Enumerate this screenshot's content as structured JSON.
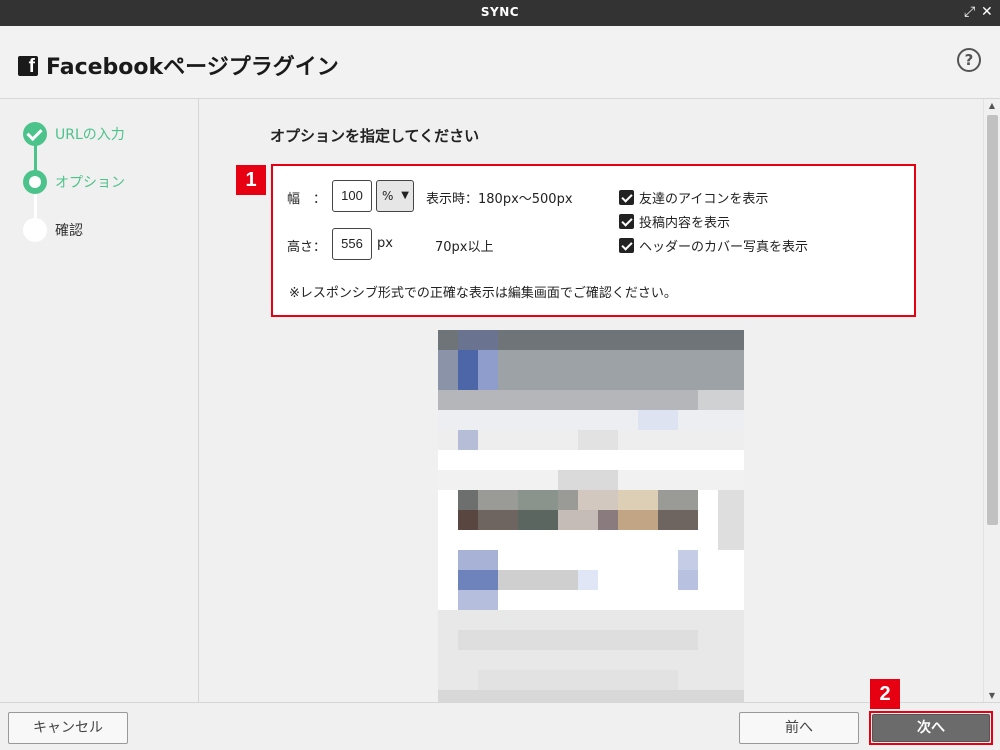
{
  "window": {
    "title": "SYNC",
    "expand_glyph": "⤢",
    "close_glyph": "✕"
  },
  "header": {
    "title": "Facebookページプラグイン",
    "icon": "facebook-icon",
    "icon_glyph": "f",
    "help_glyph": "?"
  },
  "sidebar": {
    "steps": [
      {
        "label": "URLの入力",
        "state": "done"
      },
      {
        "label": "オプション",
        "state": "active"
      },
      {
        "label": "確認",
        "state": "todo"
      }
    ]
  },
  "main": {
    "heading": "オプションを指定してください",
    "options": {
      "badge": "1",
      "width_label": "幅　：",
      "width_value": "100",
      "width_unit": "%",
      "width_hint": "表示時：180px〜500px",
      "height_label": "高さ：",
      "height_value": "556",
      "height_unit": "px",
      "height_hint": "70px以上",
      "checkboxes": [
        {
          "label": "友達のアイコンを表示",
          "checked": true
        },
        {
          "label": "投稿内容を表示",
          "checked": true
        },
        {
          "label": "ヘッダーのカバー写真を表示",
          "checked": true
        }
      ],
      "note": "※レスポンシブ形式での正確な表示は編集画面でご確認ください。"
    }
  },
  "footer": {
    "cancel_label": "キャンセル",
    "prev_label": "前へ",
    "next_label": "次へ",
    "next_badge": "2"
  },
  "colors": {
    "accent_green": "#4cc38a",
    "highlight_red": "#e60012",
    "primary_button": "#6b6b6b",
    "titlebar": "#333333"
  }
}
